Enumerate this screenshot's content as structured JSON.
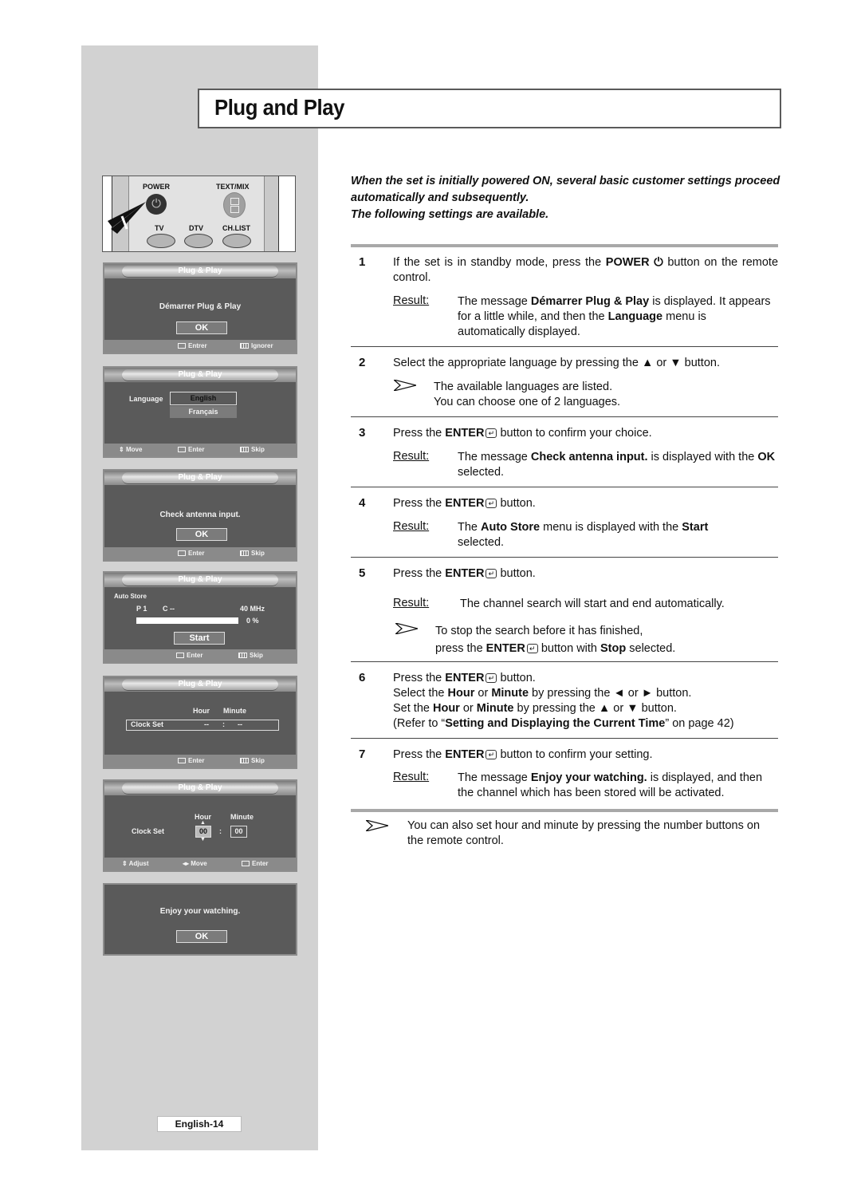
{
  "page": {
    "title": "Plug and Play",
    "page_number": "English-14"
  },
  "remote": {
    "power_label": "POWER",
    "textmix_label": "TEXT/MIX",
    "tv_label": "TV",
    "dtv_label": "DTV",
    "chlist_label": "CH.LIST",
    "power_glyph": "⏻"
  },
  "screens": {
    "header_title": "Plug & Play",
    "s1": {
      "message": "Démarrer Plug & Play",
      "ok": "OK",
      "footer": {
        "enter": "Entrer",
        "skip": "Ignorer"
      }
    },
    "s2": {
      "label": "Language",
      "options": [
        "English",
        "Français"
      ],
      "selected": "English",
      "footer": {
        "move": "Move",
        "enter": "Enter",
        "skip": "Skip"
      }
    },
    "s3": {
      "message": "Check antenna input.",
      "ok": "OK",
      "footer": {
        "enter": "Enter",
        "skip": "Skip"
      }
    },
    "s4": {
      "title": "Auto Store",
      "program": "P 1",
      "channel": "C --",
      "frequency": "40 MHz",
      "progress_percent": "0 %",
      "progress_value": 0,
      "start": "Start",
      "footer": {
        "enter": "Enter",
        "skip": "Skip"
      }
    },
    "s5": {
      "hour_label": "Hour",
      "minute_label": "Minute",
      "row_label": "Clock Set",
      "hour_value": "--",
      "sep": ":",
      "minute_value": "--",
      "footer": {
        "enter": "Enter",
        "skip": "Skip"
      }
    },
    "s6": {
      "hour_label": "Hour",
      "minute_label": "Minute",
      "row_label": "Clock Set",
      "hour_value": "00",
      "sep": ":",
      "minute_value": "00",
      "footer": {
        "adjust": "Adjust",
        "move": "Move",
        "enter": "Enter"
      }
    },
    "s7": {
      "message": "Enjoy your watching.",
      "ok": "OK"
    }
  },
  "intro": {
    "line1": "When the set is initially powered ON, several basic customer settings proceed automatically and subsequently.",
    "line2": "The following settings are available."
  },
  "result_label": "Result:",
  "steps": [
    {
      "num": "1"
    },
    {
      "num": "2"
    },
    {
      "num": "3"
    },
    {
      "num": "4"
    },
    {
      "num": "5"
    },
    {
      "num": "6"
    },
    {
      "num": "7"
    }
  ],
  "text": {
    "s1_a": "If the set is in standby mode, press the ",
    "s1_b": "POWER",
    "s1_c": " button on the remote control.",
    "s1_r_a": "The message ",
    "s1_r_b": "Démarrer Plug & Play",
    "s1_r_c": " is displayed. It appears for a little while, and then the ",
    "s1_r_d": "Language",
    "s1_r_e": " menu is automatically displayed.",
    "s2_a": "Select the appropriate language by pressing the ▲ or ▼ button.",
    "s2_n1": "The available languages are listed.",
    "s2_n2": "You can choose one of 2 languages.",
    "press_the": "Press the ",
    "enter": "ENTER",
    "s3_b": " button to confirm your choice.",
    "s3_r_a": "The message ",
    "s3_r_b": "Check antenna input.",
    "s3_r_c": " is displayed with the ",
    "s3_r_d": "OK",
    "s3_r_e": " selected.",
    "button_dot": " button.",
    "s4_r_a": "The ",
    "s4_r_b": "Auto Store",
    "s4_r_c": " menu is displayed with the ",
    "s4_r_d": "Start",
    "s4_r_e": " selected.",
    "s5_r": "The channel search will start and end automatically.",
    "s5_n1": "To stop the search before it has finished,",
    "s5_n2_a": "press the ",
    "s5_n2_c": " button with ",
    "s5_n2_d": "Stop",
    "s5_n2_e": " selected.",
    "s6_l2_a": "Select the ",
    "s6_hour": "Hour",
    "s6_or": " or ",
    "s6_minute": "Minute",
    "s6_l2_b": " by pressing the ◄ or ► button.",
    "s6_l3_a": "Set the ",
    "s6_l3_b": " by pressing the ▲ or ▼ button.",
    "s6_l4_a": "(Refer to “",
    "s6_l4_b": "Setting and Displaying the Current Time",
    "s6_l4_c": "” on page 42)",
    "s7_b": " button to confirm your setting.",
    "s7_r_a": "The message ",
    "s7_r_b": "Enjoy your watching.",
    "s7_r_c": " is displayed, and then the channel which has been stored will be activated.",
    "final_note": "You can also set hour and minute by pressing the number buttons on the remote control."
  }
}
